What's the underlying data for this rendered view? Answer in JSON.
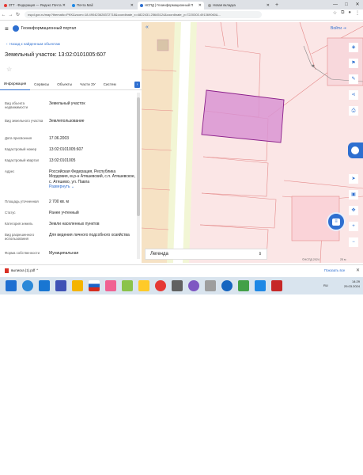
{
  "browser": {
    "tabs": [
      {
        "label": "ЗТТ · Федерация — Яндекс Почта",
        "active": false,
        "color": "#e53935"
      },
      {
        "label": "Почта Mail",
        "active": false,
        "color": "#1e88e5"
      },
      {
        "label": "НСПД | Геоинформационный П",
        "active": true,
        "color": "#2e6fd0"
      },
      {
        "label": "Новая вкладка",
        "active": false,
        "color": "#9e9e9e"
      }
    ],
    "new_tab": "+",
    "url": "nspd.gov.ru/map?thematic=PKK&zoom=18.490423628372718&coordinate_x=4822431.25645124&coordinate_y=7220303.491369060&...",
    "window_controls": [
      "—",
      "□",
      "✕"
    ]
  },
  "portal": {
    "title": "Геоинформационный портал"
  },
  "panel": {
    "back_link": "Назад к найденным объектам",
    "title": "Земельный участок: 13:02:0101005:607",
    "tabs": [
      "Информация",
      "Сервисы",
      "Объекты",
      "Части ЗУ",
      "Систем"
    ],
    "tab_next": "›",
    "rows": [
      {
        "key": "Вид объекта недвижимости",
        "value": "Земельный участок"
      },
      {
        "key": "Вид земельного участка",
        "value": "Землепользование"
      },
      {
        "key": "Дата присвоения",
        "value": "17.06.2003"
      },
      {
        "key": "Кадастровый номер",
        "value": "13:02:0101005:607"
      },
      {
        "key": "Кадастровый квартал",
        "value": "13:02:0101005"
      },
      {
        "key": "Адрес",
        "value": "Российская Федерация, Республика Мордовия, м.р-н Атяшевский, с.п. Атяшевское, с. Атяшево, ул. Павла",
        "more": "Развернуть ⌄"
      },
      {
        "key": "Площадь уточненная",
        "value": "2 700 кв. м"
      },
      {
        "key": "Статус",
        "value": "Ранее учтенный"
      },
      {
        "key": "Категория земель",
        "value": "Земли населенных пунктов"
      },
      {
        "key": "Вид разрешенного использования",
        "value": "Для ведения личного подсобного хозяйства"
      },
      {
        "key": "Форма собственности",
        "value": "Муниципальная"
      }
    ]
  },
  "map": {
    "collapse": "«",
    "top_button": "Войти",
    "legend": "Легенда",
    "legend_chevron": "⌃⌄",
    "attribution": "©НСПД 2024",
    "scale": "25 м",
    "right_controls": [
      "layers-icon",
      "measure-icon",
      "share-icon",
      "print-icon"
    ],
    "right_controls_lower": [
      "navigate-icon",
      "grid-icon",
      "pan-icon",
      "zoom-in",
      "zoom-out"
    ],
    "zoom_in": "+",
    "zoom_out": "−",
    "highlight_color": "#c65bb8"
  },
  "downloads": {
    "file": "выписка (1).pdf",
    "show_all": "Показать все",
    "close": "✕"
  },
  "taskbar": {
    "lang": "RU",
    "time": "14:29",
    "date": "29.03.2024"
  }
}
